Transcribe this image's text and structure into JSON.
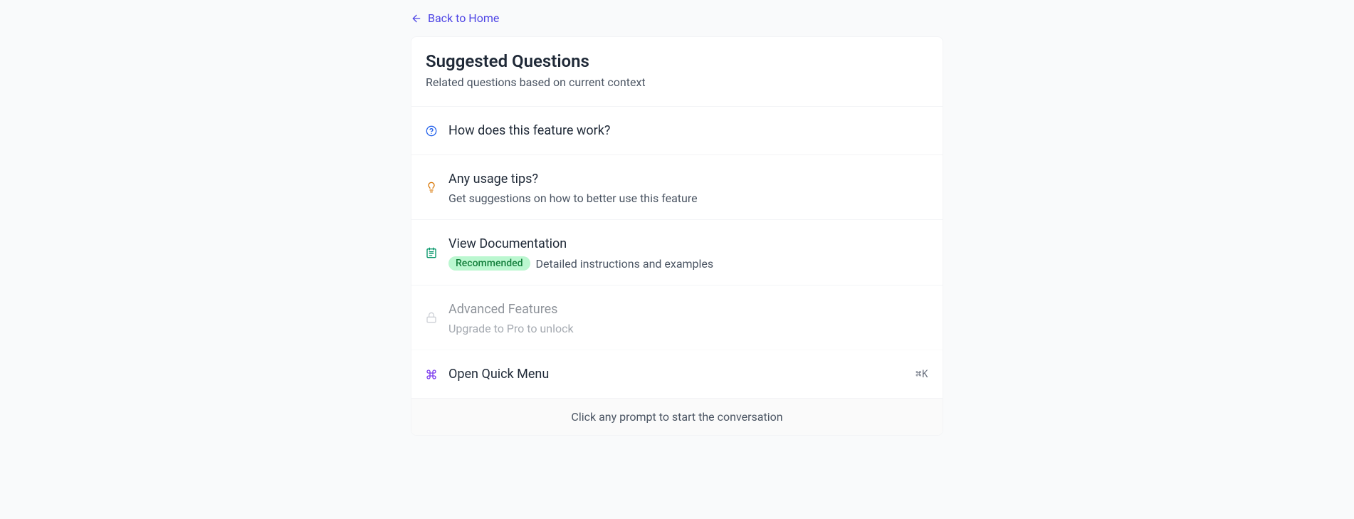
{
  "back_link": {
    "label": "Back to Home"
  },
  "card": {
    "title": "Suggested Questions",
    "subtitle": "Related questions based on current context"
  },
  "items": [
    {
      "title": "How does this feature work?"
    },
    {
      "title": "Any usage tips?",
      "description": "Get suggestions on how to better use this feature"
    },
    {
      "title": "View Documentation",
      "badge": "Recommended",
      "description": "Detailed instructions and examples"
    },
    {
      "title": "Advanced Features",
      "description": "Upgrade to Pro to unlock"
    },
    {
      "title": "Open Quick Menu",
      "shortcut": "⌘K"
    }
  ],
  "footer": {
    "text": "Click any prompt to start the conversation"
  }
}
